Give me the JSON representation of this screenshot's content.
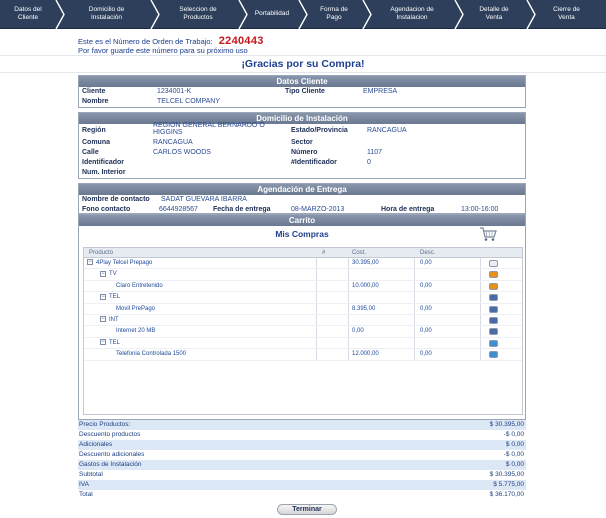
{
  "wizard": {
    "steps": [
      "Datos del\nCliente",
      "Domicilio de\nInstalación",
      "Seleccion de\nProductos",
      "Portabilidad",
      "Forma de\nPago",
      "Agendacion de\nInstalacion",
      "Detalle de\nVenta",
      "Cierre de\nVenta"
    ]
  },
  "order": {
    "label": "Este es el Número de Orden de Trabajo:",
    "number": "2240443",
    "note": "Por favor guarde este número para su próximo uso"
  },
  "thanks": "¡Gracias por su Compra!",
  "cliente": {
    "title": "Datos Cliente",
    "cliente_label": "Cliente",
    "cliente_value": "1234001-K",
    "tipo_label": "Tipo Cliente",
    "tipo_value": "EMPRESA",
    "nombre_label": "Nombre",
    "nombre_value": "TELCEL COMPANY"
  },
  "domicilio": {
    "title": "Domicilio de Instalación",
    "region_label": "Región",
    "region_value_1": "REGION GENERAL BERNARDO O",
    "region_value_2": "HIGGINS",
    "estado_label": "Estado/Provincia",
    "estado_value": "RANCAGUA",
    "comuna_label": "Comuna",
    "comuna_value": "RANCAGUA",
    "sector_label": "Sector",
    "calle_label": "Calle",
    "calle_value": "CARLOS WOODS",
    "numero_label": "Número",
    "numero_value": "1107",
    "identificador_label": "Identificador",
    "hash_ident_label": "#Identificador",
    "hash_ident_value": "0",
    "interior_label": "Num. Interior"
  },
  "agendacion": {
    "title": "Agendación de Entrega",
    "contacto_label": "Nombre de contacto",
    "contacto_value": "SADAT GUEVARA IBARRA",
    "fono_label": "Fono contacto",
    "fono_value": "6644928567",
    "fecha_label": "Fecha de entrega",
    "fecha_value": "08-MARZO-2013",
    "hora_label": "Hora de entrega",
    "hora_value": "13:00-16:00"
  },
  "carrito": {
    "title": "Carrito",
    "subtitle": "Mis Compras",
    "cart_icon": "shopping-cart-icon",
    "columns": {
      "producto": "Producto",
      "num": "#",
      "cost": "Cost.",
      "desc": "Desc."
    },
    "rows": [
      {
        "name": "4Play Telcel Prepago",
        "level": 0,
        "expander": true,
        "cost": "30.395,00",
        "desc": "0,00",
        "icon": "document-icon",
        "icon_color": "#e9eef5"
      },
      {
        "name": "TV",
        "level": 1,
        "expander": true,
        "cost": "",
        "desc": "",
        "icon": "tv-icon",
        "icon_color": "#e7911c"
      },
      {
        "name": "Claro Entretenido",
        "level": 2,
        "expander": false,
        "cost": "10.000,00",
        "desc": "0,00",
        "icon": "tv-icon",
        "icon_color": "#e7911c"
      },
      {
        "name": "TEL",
        "level": 1,
        "expander": true,
        "cost": "",
        "desc": "",
        "icon": "phone-icon",
        "icon_color": "#4a6aa8"
      },
      {
        "name": "Movil PrePago",
        "level": 2,
        "expander": false,
        "cost": "8.395,00",
        "desc": "0,00",
        "icon": "phone-icon",
        "icon_color": "#4a6aa8"
      },
      {
        "name": "INT",
        "level": 1,
        "expander": true,
        "cost": "",
        "desc": "",
        "icon": "network-icon",
        "icon_color": "#4a6aa8"
      },
      {
        "name": "Internet 20 MB",
        "level": 2,
        "expander": false,
        "cost": "0,00",
        "desc": "0,00",
        "icon": "network-icon",
        "icon_color": "#4a6aa8"
      },
      {
        "name": "TEL",
        "level": 1,
        "expander": true,
        "cost": "",
        "desc": "",
        "icon": "landline-icon",
        "icon_color": "#3d8fd0"
      },
      {
        "name": "Telefonia Controlada 1500",
        "level": 2,
        "expander": false,
        "cost": "12.000,00",
        "desc": "0,00",
        "icon": "landline-icon",
        "icon_color": "#3d8fd0"
      }
    ]
  },
  "totals": [
    {
      "label": "Precio Productos:",
      "value": "$ 30.395,00"
    },
    {
      "label": "Descuento productos",
      "value": "-$ 0,00"
    },
    {
      "label": "Adicionales",
      "value": "$ 0,00"
    },
    {
      "label": "Descuento adicionales",
      "value": "-$ 0,00"
    },
    {
      "label": "Gastos de Instalación",
      "value": "$ 0,00"
    },
    {
      "label": "Subtotal",
      "value": "$ 30.395,00"
    },
    {
      "label": "IVA",
      "value": "$ 5.775,00"
    },
    {
      "label": "Total",
      "value": "$ 36.170,00"
    }
  ],
  "terminar_button": "Terminar",
  "colors": {
    "nav_bg": "#2d3f5b",
    "order_number": "#c4171b",
    "panel_header": "#7a879e",
    "totals_stripe": "#dde8f6"
  }
}
